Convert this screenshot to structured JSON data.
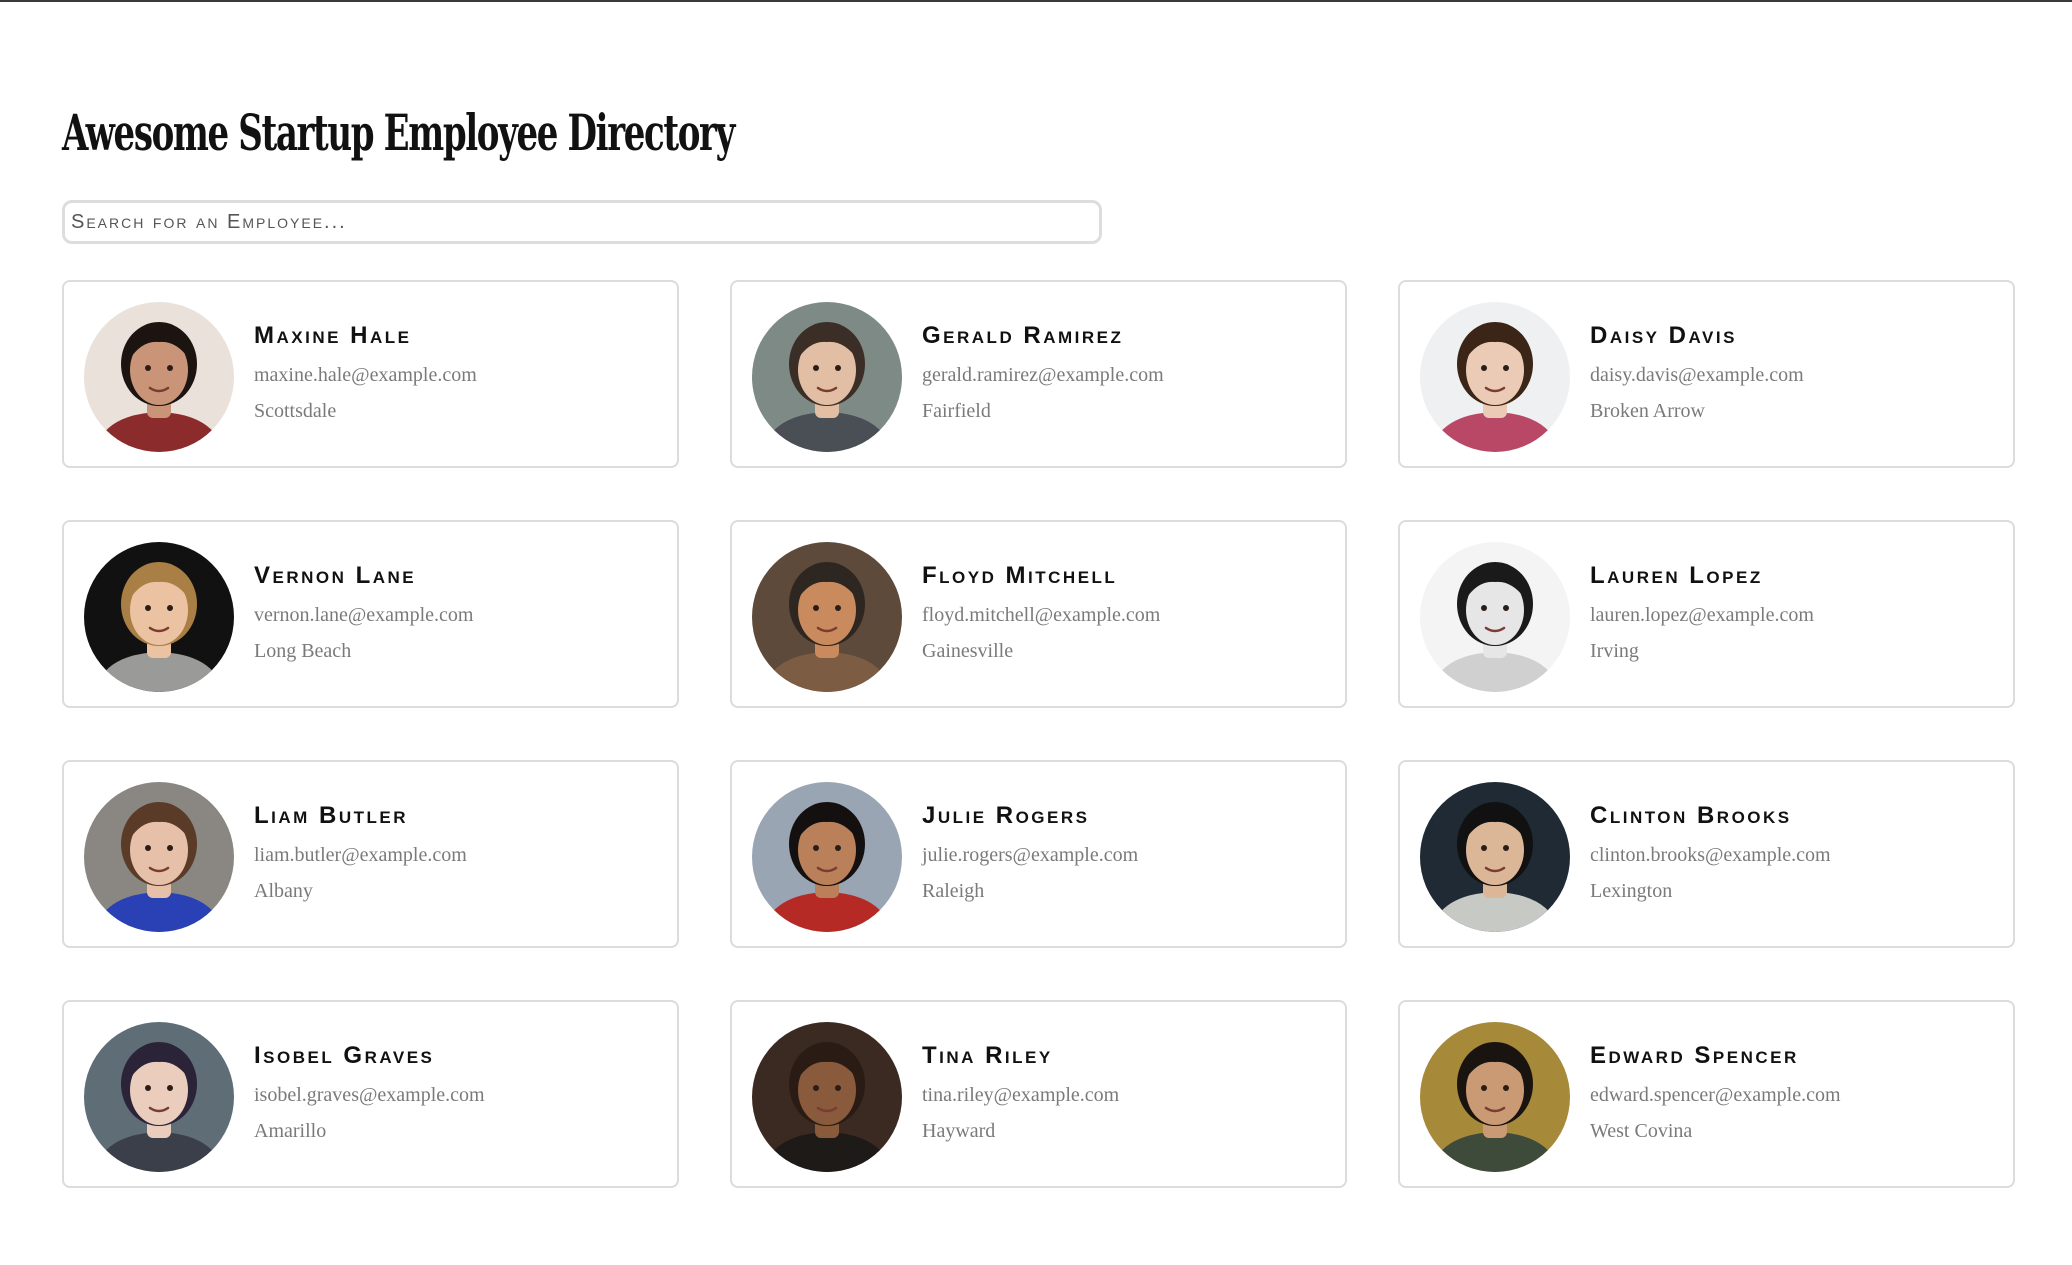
{
  "header": {
    "title": "Awesome Startup Employee Directory"
  },
  "search": {
    "placeholder": "Search for an Employee..."
  },
  "employees": [
    {
      "name": "Maxine Hale",
      "email": "maxine.hale@example.com",
      "city": "Scottsdale",
      "skin": "#c99477",
      "hair": "#1c1410",
      "bg": "#e9e1da",
      "shirt": "#8b2b2b"
    },
    {
      "name": "Gerald Ramirez",
      "email": "gerald.ramirez@example.com",
      "city": "Fairfield",
      "skin": "#e2bfa4",
      "hair": "#3a2e26",
      "bg": "#7d8a86",
      "shirt": "#4a4f55"
    },
    {
      "name": "Daisy Davis",
      "email": "daisy.davis@example.com",
      "city": "Broken Arrow",
      "skin": "#eccbb6",
      "hair": "#3b2517",
      "bg": "#eef0f1",
      "shirt": "#b94867"
    },
    {
      "name": "Vernon Lane",
      "email": "vernon.lane@example.com",
      "city": "Long Beach",
      "skin": "#ecc3a2",
      "hair": "#a97f45",
      "bg": "#111111",
      "shirt": "#9a9a98"
    },
    {
      "name": "Floyd Mitchell",
      "email": "floyd.mitchell@example.com",
      "city": "Gainesville",
      "skin": "#c98a5e",
      "hair": "#2e2620",
      "bg": "#5d4a3a",
      "shirt": "#7d5c44"
    },
    {
      "name": "Lauren Lopez",
      "email": "lauren.lopez@example.com",
      "city": "Irving",
      "skin": "#e6e6e6",
      "hair": "#1a1a1a",
      "bg": "#f4f4f4",
      "shirt": "#d0d0d0"
    },
    {
      "name": "Liam Butler",
      "email": "liam.butler@example.com",
      "city": "Albany",
      "skin": "#e7c0aa",
      "hair": "#5a3b28",
      "bg": "#8a8783",
      "shirt": "#2941b5"
    },
    {
      "name": "Julie Rogers",
      "email": "julie.rogers@example.com",
      "city": "Raleigh",
      "skin": "#b9805a",
      "hair": "#141010",
      "bg": "#9aa5b3",
      "shirt": "#b52a24"
    },
    {
      "name": "Clinton Brooks",
      "email": "clinton.brooks@example.com",
      "city": "Lexington",
      "skin": "#dcb797",
      "hair": "#111111",
      "bg": "#1f2a34",
      "shirt": "#c7c9c4"
    },
    {
      "name": "Isobel Graves",
      "email": "isobel.graves@example.com",
      "city": "Amarillo",
      "skin": "#eacdbd",
      "hair": "#2b2438",
      "bg": "#5f6d77",
      "shirt": "#3a3f4a"
    },
    {
      "name": "Tina Riley",
      "email": "tina.riley@example.com",
      "city": "Hayward",
      "skin": "#8a5a3c",
      "hair": "#2a1c14",
      "bg": "#3b2a22",
      "shirt": "#1e1a18"
    },
    {
      "name": "Edward Spencer",
      "email": "edward.spencer@example.com",
      "city": "West Covina",
      "skin": "#c99a73",
      "hair": "#1a1410",
      "bg": "#a68a3a",
      "shirt": "#3e4a3a"
    }
  ]
}
